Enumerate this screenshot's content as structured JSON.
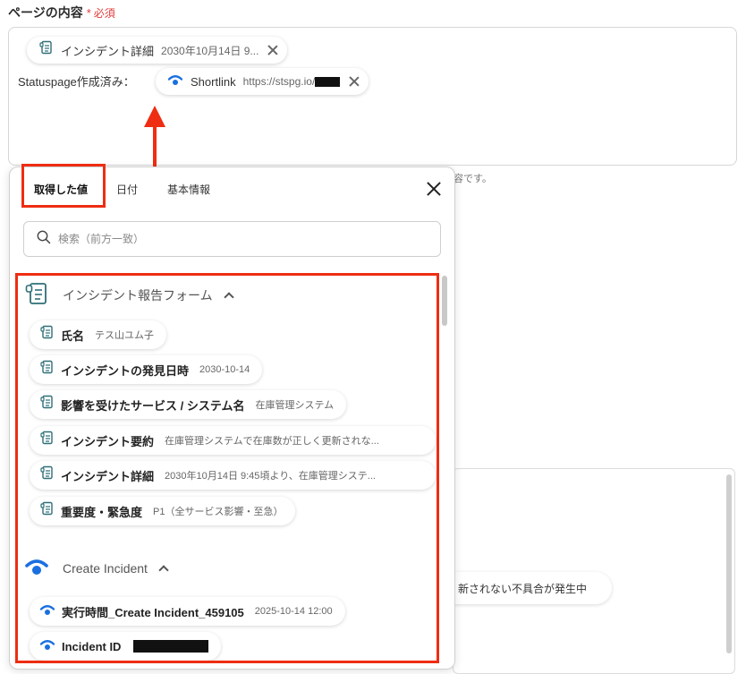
{
  "section": {
    "label": "ページの内容",
    "required_star": "*",
    "required_text": "必須"
  },
  "content": {
    "chip1": {
      "name": "インシデント詳細",
      "value": "2030年10月14日 9..."
    },
    "status_label": "Statuspage作成済み：",
    "chip2": {
      "name": "Shortlink",
      "value": "https://stspg.io/"
    }
  },
  "bg": {
    "desc_fragment": "容です。",
    "chip_text": "新されない不具合が発生中"
  },
  "panel": {
    "tabs": [
      "取得した値",
      "日付",
      "基本情報"
    ],
    "search_placeholder": "検索（前方一致）",
    "groups": [
      {
        "title": "インシデント報告フォーム",
        "icon": "form-icon",
        "items": [
          {
            "name": "氏名",
            "value": "テス山ユム子"
          },
          {
            "name": "インシデントの発見日時",
            "value": "2030-10-14"
          },
          {
            "name": "影響を受けたサービス / システム名",
            "value": "在庫管理システム"
          },
          {
            "name": "インシデント要約",
            "value": "在庫管理システムで在庫数が正しく更新されな..."
          },
          {
            "name": "インシデント詳細",
            "value": "2030年10月14日 9:45頃より、在庫管理システ..."
          },
          {
            "name": "重要度・緊急度",
            "value": "P1（全サービス影響・至急）"
          }
        ]
      },
      {
        "title": "Create Incident",
        "icon": "statuspage-icon",
        "items": [
          {
            "name": "実行時間_Create Incident_459105",
            "value": "2025-10-14 12:00"
          },
          {
            "name": "Incident ID",
            "value": ""
          }
        ]
      }
    ]
  },
  "colors": {
    "highlight": "#ee2d12",
    "statuspage_blue": "#1a6fe0",
    "form_teal": "#2f6f78"
  }
}
